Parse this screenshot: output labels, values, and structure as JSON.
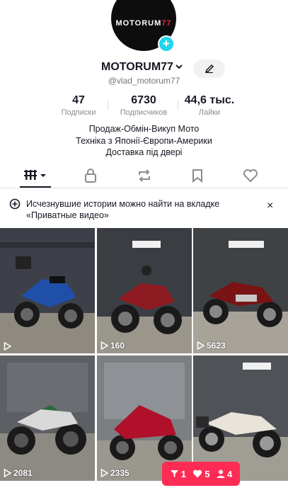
{
  "profile": {
    "avatar_logo_prefix": "MOTORUM",
    "avatar_logo_suffix": "77",
    "username": "MOTORUM77",
    "handle": "@vlad_motorum77",
    "avatar_plus": "+"
  },
  "stats": [
    {
      "value": "47",
      "label": "Подписки"
    },
    {
      "value": "6730",
      "label": "Подписчиков"
    },
    {
      "value": "44,6 тыс.",
      "label": "Лайки"
    }
  ],
  "bio": [
    "Продаж-Обмін-Викуп Мото",
    "Техніка з Японії-Європи-Америки",
    "Доставка під двері"
  ],
  "tabs": [
    "videos-grid-icon",
    "lock-icon",
    "repost-icon",
    "bookmark-icon",
    "heart-icon"
  ],
  "notice": {
    "text": "Исчезнувшие истории можно найти на вкладке «Приватные видео»",
    "close": "×"
  },
  "videos": [
    {
      "views": "",
      "tile_color": "#3b4d6b",
      "bike_color": "#1f4fa8"
    },
    {
      "views": "160",
      "tile_color": "#4a4f55",
      "bike_color": "#8e1b22"
    },
    {
      "views": "5623",
      "tile_color": "#4d4f52",
      "bike_color": "#7a1414"
    },
    {
      "views": "2081",
      "tile_color": "#5c6064",
      "bike_color": "#d9d9d9"
    },
    {
      "views": "2335",
      "tile_color": "#7c7f82",
      "bike_color": "#b0102a"
    },
    {
      "views": "",
      "tile_color": "#4f5357",
      "bike_color": "#e8e4da"
    }
  ],
  "floating": {
    "inbox": "1",
    "likes": "5",
    "followers": "4"
  },
  "colors": {
    "accent": "#fe2c55",
    "plus": "#20d5ec"
  }
}
